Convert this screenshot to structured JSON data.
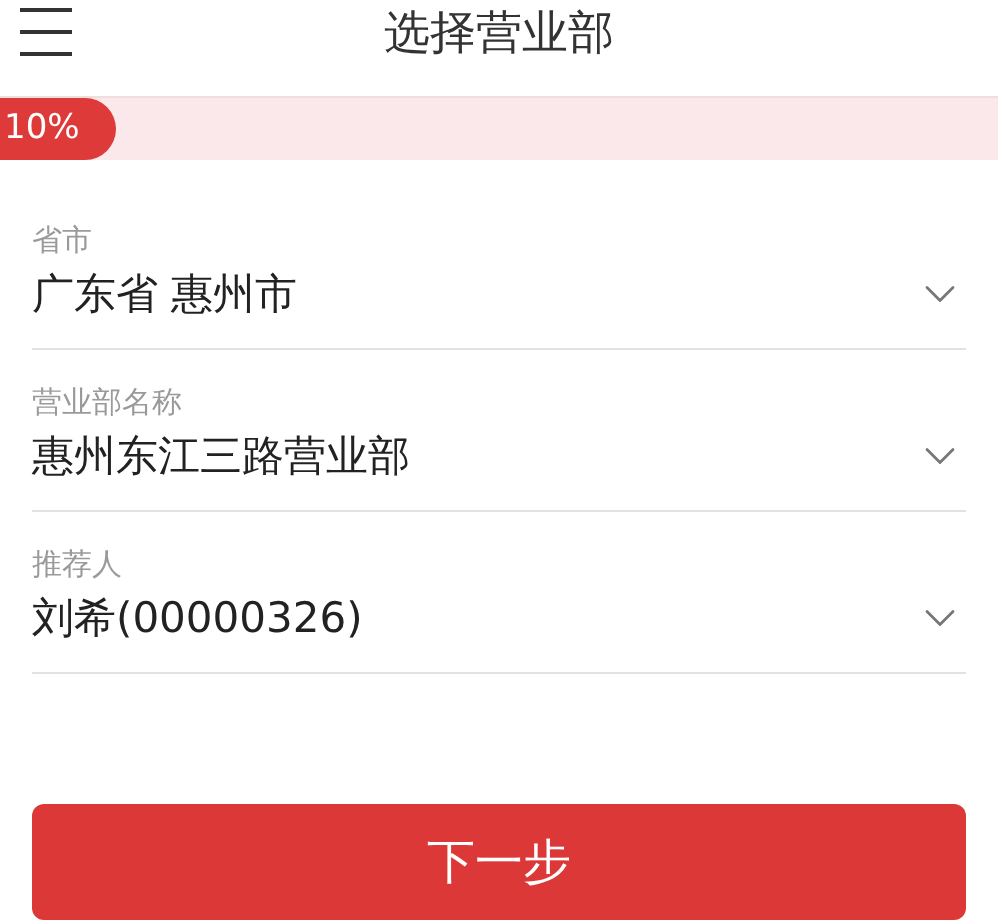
{
  "header": {
    "title": "选择营业部"
  },
  "progress": {
    "level": 0.1,
    "reading": "10%"
  },
  "fields": [
    {
      "label": "省市",
      "value": "广东省 惠州市"
    },
    {
      "label": "营业部名称",
      "value": "惠州东江三路营业部"
    },
    {
      "label": "推荐人",
      "value": "刘希(00000326)"
    }
  ],
  "next_button": {
    "label": "下一步"
  }
}
